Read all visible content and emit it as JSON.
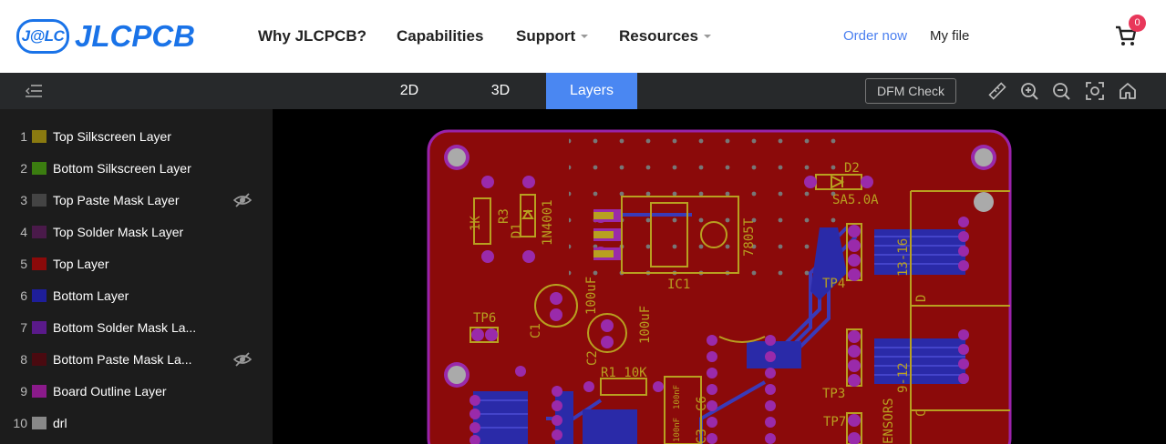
{
  "header": {
    "logo_badge": "J@LC",
    "logo_text": "JLCPCB",
    "nav": [
      {
        "label": "Why JLCPCB?"
      },
      {
        "label": "Capabilities"
      },
      {
        "label": "Support"
      },
      {
        "label": "Resources"
      }
    ],
    "order_now": "Order now",
    "my_file": "My file",
    "cart_count": "0"
  },
  "toolbar": {
    "tabs": [
      {
        "label": "2D"
      },
      {
        "label": "3D"
      },
      {
        "label": "Layers",
        "active": true
      }
    ],
    "dfm_check": "DFM Check",
    "tools": [
      "ruler-icon",
      "zoom-in-icon",
      "zoom-out-icon",
      "fit-screen-icon",
      "home-icon"
    ]
  },
  "layers": [
    {
      "num": "1",
      "label": "Top Silkscreen Layer",
      "color": "#8a7a10",
      "hidden": false
    },
    {
      "num": "2",
      "label": "Bottom Silkscreen Layer",
      "color": "#3b7d10",
      "hidden": false
    },
    {
      "num": "3",
      "label": "Top Paste Mask Layer",
      "color": "#444444",
      "hidden": true
    },
    {
      "num": "4",
      "label": "Top Solder Mask Layer",
      "color": "#4a1a4a",
      "hidden": false
    },
    {
      "num": "5",
      "label": "Top Layer",
      "color": "#8b0a0a",
      "hidden": false
    },
    {
      "num": "6",
      "label": "Bottom Layer",
      "color": "#1e1e9a",
      "hidden": false
    },
    {
      "num": "7",
      "label": "Bottom Solder Mask La...",
      "color": "#5a1a8a",
      "hidden": false
    },
    {
      "num": "8",
      "label": "Bottom Paste Mask La...",
      "color": "#4a0a10",
      "hidden": true
    },
    {
      "num": "9",
      "label": "Board Outline Layer",
      "color": "#8a1a8a",
      "hidden": false
    },
    {
      "num": "10",
      "label": "drl",
      "color": "#888888",
      "hidden": false
    }
  ],
  "pcb_labels": {
    "r3": "R3",
    "k1": "1K",
    "d1": "D1",
    "n4001": "1N4001",
    "d2": "D2",
    "sa5": "SA5.0A",
    "ic1": "IC1",
    "reg": "7805T",
    "tp6": "TP6",
    "tp4": "TP4",
    "tp3": "TP3",
    "tp7": "TP7",
    "c1": "C1",
    "c2": "C2",
    "cap1": "100uF",
    "cap2": "100uF",
    "r1": "R1 10K",
    "range1": "13-16",
    "range2": "9-12",
    "sensors": "ENSORS",
    "d": "D",
    "c": "C",
    "c6": "C6",
    "c3": "C3",
    "nf1": "100nF",
    "nf2": "100nF"
  },
  "colors": {
    "accent": "#4a87f2",
    "board": "#8b0a0a",
    "silk": "#b8a020",
    "outline": "#9a22aa",
    "bottom": "#3a3ab8"
  }
}
